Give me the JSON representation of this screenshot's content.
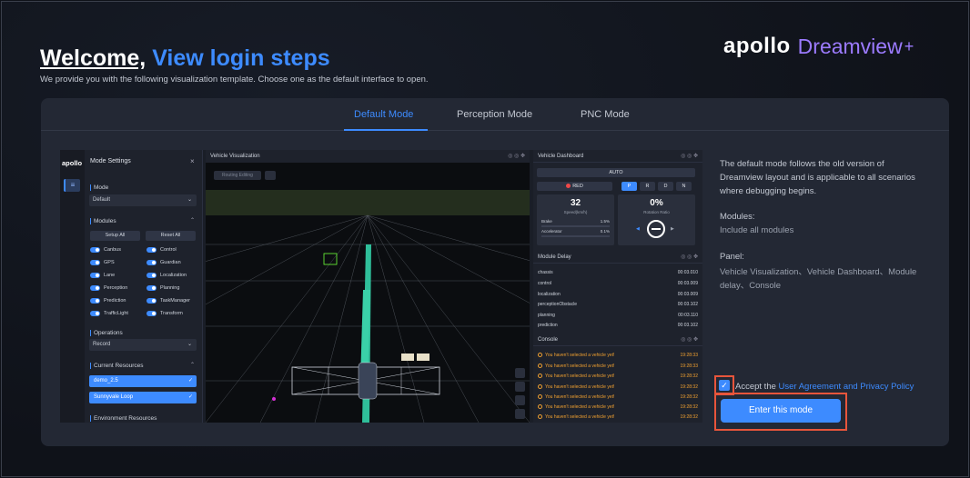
{
  "header": {
    "welcome": "Welcome,",
    "link": "View login steps",
    "subtitle": "We provide you with the following visualization template. Choose one as the default interface to open."
  },
  "brand": {
    "apollo": "apollo",
    "product": "Dreamview",
    "plus": "+"
  },
  "tabs": [
    {
      "label": "Default Mode",
      "active": true
    },
    {
      "label": "Perception Mode",
      "active": false
    },
    {
      "label": "PNC Mode",
      "active": false
    }
  ],
  "preview": {
    "logo": "apollo",
    "settings_title": "Mode Settings",
    "close": "×",
    "mode_label": "Mode",
    "mode_value": "Default",
    "modules_label": "Modules",
    "setup_all": "Setup All",
    "reset_all": "Reset All",
    "modules": [
      "Canbus",
      "Control",
      "GPS",
      "Guardian",
      "Lane",
      "Localization",
      "Perception",
      "Planning",
      "Prediction",
      "TaskManager",
      "TrafficLight",
      "Transform"
    ],
    "operations_label": "Operations",
    "operations_value": "Record",
    "resources_label": "Current Resources",
    "resources": [
      "demo_2.5",
      "Sunnyvale Loop"
    ],
    "env_label": "Environment Resources",
    "viz_title": "Vehicle Visualization",
    "routing_btn": "Routing Editing",
    "dashboard_title": "Vehicle Dashboard",
    "auto": "AUTO",
    "signal": "RED",
    "gears": [
      "P",
      "R",
      "D",
      "N"
    ],
    "speed": "32",
    "speed_label": "Speed(km/h)",
    "brake_label": "Brake",
    "brake_value": "1.5%",
    "accel_label": "Accelerator",
    "accel_value": "0.1%",
    "rotation": "0%",
    "rotation_label": "Rotation Ratio",
    "delay_title": "Module Delay",
    "delays": [
      {
        "name": "chassis",
        "value": "00:03.010"
      },
      {
        "name": "control",
        "value": "00:03.009"
      },
      {
        "name": "localization",
        "value": "00:03.009"
      },
      {
        "name": "perceptionObstacle",
        "value": "00:03.102"
      },
      {
        "name": "planning",
        "value": "00:03.110"
      },
      {
        "name": "prediction",
        "value": "00:03.102"
      }
    ],
    "console_title": "Console",
    "console": [
      {
        "msg": "You haven't selected a vehicle yet!",
        "time": "19:28:33"
      },
      {
        "msg": "You haven't selected a vehicle yet!",
        "time": "19:28:33"
      },
      {
        "msg": "You haven't selected a vehicle yet!",
        "time": "19:28:32"
      },
      {
        "msg": "You haven't selected a vehicle yet!",
        "time": "19:28:32"
      },
      {
        "msg": "You haven't selected a vehicle yet!",
        "time": "19:28:32"
      },
      {
        "msg": "You haven't selected a vehicle yet!",
        "time": "19:28:32"
      },
      {
        "msg": "You haven't selected a vehicle yet!",
        "time": "19:28:32"
      },
      {
        "msg": "You haven't selected a vehicle yet!",
        "time": "19:28:32"
      }
    ]
  },
  "description": {
    "intro": "The default mode follows the old version of Dreamview layout and is applicable to all scenarios where debugging begins.",
    "modules_heading": "Modules:",
    "modules_text": "Include all modules",
    "panel_heading": "Panel:",
    "panel_text": "Vehicle Visualization、Vehicle Dashboard、Module delay、Console"
  },
  "agreement": {
    "prefix": "Accept the",
    "link": "User Agreement and Privacy Policy",
    "checked": true
  },
  "enter_button": "Enter this mode",
  "colors": {
    "accent": "#3d8bff",
    "brand_purple": "#9c7bff",
    "highlight_box": "#e8553b"
  }
}
